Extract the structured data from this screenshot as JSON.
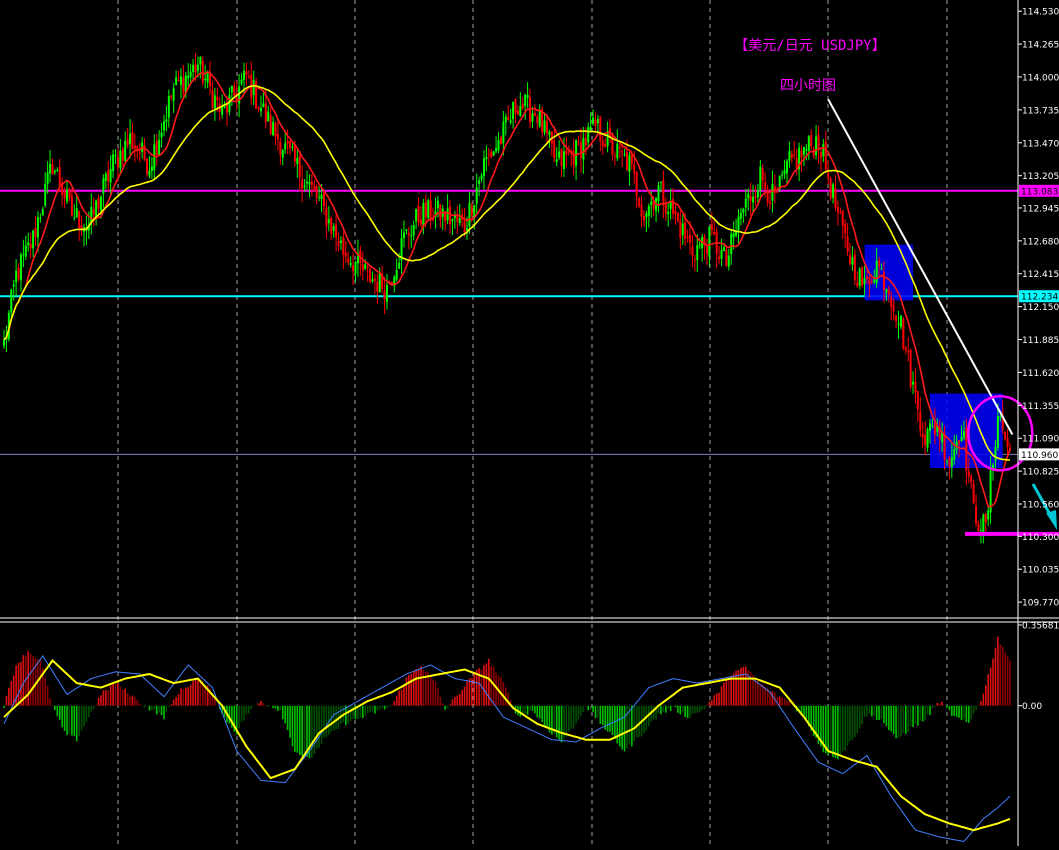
{
  "colors": {
    "background": "#000000",
    "bull_candle": "#00ff00",
    "bear_candle": "#ff0000",
    "ma_fast": "#ff1a1a",
    "ma_slow": "#ffff00",
    "resistance_line": "#ff00ff",
    "support_line": "#00ffff",
    "box_fill": "#0000ff",
    "trendline": "#ffffff",
    "circle": "#ff00ff",
    "arrow": "#00c8d8",
    "title": "#ff00ff",
    "axis_text": "#ffffff",
    "macd_pos": "#e01010",
    "macd_pos_dark": "#8b0000",
    "macd_neg": "#00c000",
    "macd_neg_dark": "#005000",
    "signal": "#ffff00",
    "macd_line": "#4080ff",
    "grid": "#ffffff"
  },
  "chart_data": [
    {
      "type": "candlestick",
      "title": "【美元/日元 USDJPY】",
      "subtitle": "四小时图",
      "ylim": [
        109.65,
        114.62
      ],
      "y_ticks": [
        "114.530",
        "114.265",
        "114.000",
        "113.735",
        "113.470",
        "113.205",
        "112.945",
        "112.680",
        "112.415",
        "112.150",
        "111.885",
        "111.620",
        "111.355",
        "111.090",
        "110.825",
        "110.560",
        "110.300",
        "110.035",
        "109.770"
      ],
      "tick_values": [
        114.53,
        114.265,
        114.0,
        113.735,
        113.47,
        113.205,
        112.945,
        112.68,
        112.415,
        112.15,
        111.885,
        111.62,
        111.355,
        111.09,
        110.825,
        110.56,
        110.3,
        110.035,
        109.77
      ],
      "horizontal_levels": [
        {
          "label": "113.083",
          "value": 113.083,
          "kind": "resistance"
        },
        {
          "label": "112.234",
          "value": 112.234,
          "kind": "support"
        },
        {
          "label": "110.960",
          "value": 110.96,
          "kind": "current"
        }
      ],
      "bottom_level": 110.32,
      "ohlc_anchors": [
        [
          0,
          111.85
        ],
        [
          5,
          112.4
        ],
        [
          12,
          112.7
        ],
        [
          20,
          113.3
        ],
        [
          28,
          112.9
        ],
        [
          35,
          112.8
        ],
        [
          45,
          113.3
        ],
        [
          52,
          113.5
        ],
        [
          60,
          113.3
        ],
        [
          70,
          113.9
        ],
        [
          80,
          114.1
        ],
        [
          90,
          113.7
        ],
        [
          100,
          114.0
        ],
        [
          110,
          113.6
        ],
        [
          120,
          113.3
        ],
        [
          130,
          113.0
        ],
        [
          140,
          112.6
        ],
        [
          150,
          112.4
        ],
        [
          158,
          112.3
        ],
        [
          165,
          112.7
        ],
        [
          172,
          112.9
        ],
        [
          180,
          112.9
        ],
        [
          190,
          112.8
        ],
        [
          198,
          113.3
        ],
        [
          205,
          113.5
        ],
        [
          212,
          113.8
        ],
        [
          220,
          113.7
        ],
        [
          228,
          113.3
        ],
        [
          236,
          113.4
        ],
        [
          244,
          113.6
        ],
        [
          252,
          113.4
        ],
        [
          258,
          113.3
        ],
        [
          264,
          112.9
        ],
        [
          270,
          113.1
        ],
        [
          276,
          112.9
        ],
        [
          284,
          112.6
        ],
        [
          292,
          112.7
        ],
        [
          298,
          112.5
        ],
        [
          304,
          112.9
        ],
        [
          312,
          113.2
        ],
        [
          318,
          113.0
        ],
        [
          324,
          113.3
        ],
        [
          330,
          113.4
        ],
        [
          336,
          113.5
        ],
        [
          340,
          113.2
        ],
        [
          345,
          112.8
        ],
        [
          350,
          112.5
        ],
        [
          355,
          112.3
        ],
        [
          360,
          112.5
        ],
        [
          365,
          112.3
        ],
        [
          370,
          112.0
        ],
        [
          375,
          111.5
        ],
        [
          380,
          111.1
        ],
        [
          385,
          111.2
        ],
        [
          390,
          110.9
        ],
        [
          395,
          111.2
        ],
        [
          400,
          110.5
        ],
        [
          405,
          110.35
        ],
        [
          410,
          111.3
        ],
        [
          415,
          110.96
        ]
      ]
    },
    {
      "type": "bar",
      "y_ticks": [
        "0.35681",
        "0.00"
      ],
      "tick_values": [
        0.35681,
        0.0
      ],
      "ylim": [
        -0.62,
        0.37
      ],
      "histogram_anchors": [
        [
          0,
          0
        ],
        [
          5,
          0.18
        ],
        [
          10,
          0.24
        ],
        [
          15,
          0.2
        ],
        [
          20,
          0.0
        ],
        [
          25,
          -0.12
        ],
        [
          30,
          -0.15
        ],
        [
          35,
          -0.05
        ],
        [
          40,
          0.05
        ],
        [
          46,
          0.1
        ],
        [
          52,
          0.05
        ],
        [
          58,
          0.0
        ],
        [
          66,
          -0.05
        ],
        [
          72,
          0.06
        ],
        [
          80,
          0.12
        ],
        [
          86,
          0.06
        ],
        [
          90,
          -0.04
        ],
        [
          96,
          -0.12
        ],
        [
          100,
          -0.04
        ],
        [
          106,
          0.02
        ],
        [
          114,
          -0.02
        ],
        [
          120,
          -0.2
        ],
        [
          126,
          -0.24
        ],
        [
          132,
          -0.15
        ],
        [
          140,
          -0.08
        ],
        [
          148,
          -0.05
        ],
        [
          160,
          0.0
        ],
        [
          166,
          0.12
        ],
        [
          172,
          0.18
        ],
        [
          178,
          0.1
        ],
        [
          182,
          -0.02
        ],
        [
          188,
          0.06
        ],
        [
          194,
          0.14
        ],
        [
          200,
          0.2
        ],
        [
          206,
          0.1
        ],
        [
          212,
          -0.05
        ],
        [
          218,
          -0.02
        ],
        [
          224,
          -0.1
        ],
        [
          230,
          -0.16
        ],
        [
          236,
          -0.08
        ],
        [
          240,
          0.0
        ],
        [
          248,
          -0.1
        ],
        [
          256,
          -0.2
        ],
        [
          262,
          -0.14
        ],
        [
          270,
          -0.04
        ],
        [
          276,
          -0.01
        ],
        [
          282,
          -0.05
        ],
        [
          288,
          -0.02
        ],
        [
          294,
          0.05
        ],
        [
          300,
          0.14
        ],
        [
          306,
          0.17
        ],
        [
          312,
          0.1
        ],
        [
          318,
          0.05
        ],
        [
          324,
          0.02
        ],
        [
          330,
          -0.05
        ],
        [
          338,
          -0.2
        ],
        [
          344,
          -0.23
        ],
        [
          350,
          -0.15
        ],
        [
          356,
          -0.04
        ],
        [
          362,
          -0.06
        ],
        [
          368,
          -0.15
        ],
        [
          374,
          -0.1
        ],
        [
          380,
          -0.06
        ],
        [
          386,
          0.02
        ],
        [
          392,
          -0.05
        ],
        [
          398,
          -0.08
        ],
        [
          404,
          0.05
        ],
        [
          410,
          0.3
        ],
        [
          415,
          0.2
        ]
      ],
      "signal_anchors": [
        [
          0,
          -0.05
        ],
        [
          10,
          0.05
        ],
        [
          20,
          0.2
        ],
        [
          30,
          0.1
        ],
        [
          40,
          0.08
        ],
        [
          50,
          0.12
        ],
        [
          60,
          0.14
        ],
        [
          70,
          0.1
        ],
        [
          80,
          0.12
        ],
        [
          90,
          0.0
        ],
        [
          100,
          -0.18
        ],
        [
          110,
          -0.32
        ],
        [
          120,
          -0.28
        ],
        [
          130,
          -0.12
        ],
        [
          140,
          -0.04
        ],
        [
          150,
          0.02
        ],
        [
          160,
          0.06
        ],
        [
          170,
          0.12
        ],
        [
          180,
          0.14
        ],
        [
          190,
          0.16
        ],
        [
          200,
          0.12
        ],
        [
          210,
          -0.01
        ],
        [
          220,
          -0.08
        ],
        [
          230,
          -0.12
        ],
        [
          240,
          -0.15
        ],
        [
          250,
          -0.15
        ],
        [
          260,
          -0.1
        ],
        [
          270,
          0.0
        ],
        [
          280,
          0.08
        ],
        [
          290,
          0.1
        ],
        [
          300,
          0.12
        ],
        [
          310,
          0.12
        ],
        [
          320,
          0.08
        ],
        [
          330,
          -0.05
        ],
        [
          340,
          -0.2
        ],
        [
          350,
          -0.24
        ],
        [
          360,
          -0.27
        ],
        [
          370,
          -0.4
        ],
        [
          380,
          -0.48
        ],
        [
          390,
          -0.52
        ],
        [
          400,
          -0.55
        ],
        [
          410,
          -0.52
        ],
        [
          415,
          -0.5
        ]
      ],
      "macd_anchors": [
        [
          0,
          -0.08
        ],
        [
          8,
          0.1
        ],
        [
          16,
          0.22
        ],
        [
          26,
          0.05
        ],
        [
          36,
          0.12
        ],
        [
          46,
          0.15
        ],
        [
          56,
          0.14
        ],
        [
          66,
          0.04
        ],
        [
          76,
          0.18
        ],
        [
          86,
          0.08
        ],
        [
          96,
          -0.2
        ],
        [
          106,
          -0.33
        ],
        [
          116,
          -0.34
        ],
        [
          126,
          -0.2
        ],
        [
          136,
          -0.04
        ],
        [
          146,
          0.02
        ],
        [
          156,
          0.08
        ],
        [
          166,
          0.14
        ],
        [
          176,
          0.18
        ],
        [
          186,
          0.12
        ],
        [
          196,
          0.1
        ],
        [
          206,
          -0.05
        ],
        [
          216,
          -0.1
        ],
        [
          226,
          -0.15
        ],
        [
          236,
          -0.16
        ],
        [
          246,
          -0.1
        ],
        [
          256,
          -0.05
        ],
        [
          266,
          0.08
        ],
        [
          276,
          0.12
        ],
        [
          286,
          0.1
        ],
        [
          296,
          0.12
        ],
        [
          306,
          0.14
        ],
        [
          316,
          0.06
        ],
        [
          326,
          -0.1
        ],
        [
          336,
          -0.25
        ],
        [
          346,
          -0.3
        ],
        [
          356,
          -0.22
        ],
        [
          366,
          -0.4
        ],
        [
          376,
          -0.55
        ],
        [
          386,
          -0.58
        ],
        [
          396,
          -0.6
        ],
        [
          404,
          -0.5
        ],
        [
          410,
          -0.45
        ],
        [
          415,
          -0.4
        ]
      ]
    }
  ]
}
